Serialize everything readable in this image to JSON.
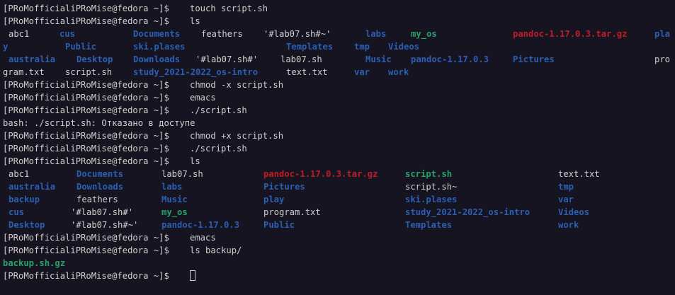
{
  "colors": {
    "background": "#171421",
    "default_text": "#d0cfcc",
    "directory": "#2a5fb3",
    "executable": "#26a269",
    "archive": "#c01c28"
  },
  "prompt": "[PRoMofficialiPRoMise@fedora ~]$",
  "lines": [
    {
      "type": "prompt",
      "cmd": "touch script.sh"
    },
    {
      "type": "prompt",
      "cmd": "ls"
    },
    {
      "type": "ls",
      "items": [
        {
          "text": "abc1",
          "kind": "def",
          "col": 1
        },
        {
          "text": "cus",
          "kind": "dir",
          "col": 10
        },
        {
          "text": "Documents",
          "kind": "dir",
          "col": 23
        },
        {
          "text": "feathers",
          "kind": "def",
          "col": 35
        },
        {
          "text": "'#lab07.sh#~'",
          "kind": "def",
          "col": 46
        },
        {
          "text": "labs",
          "kind": "dir",
          "col": 64
        },
        {
          "text": "my_os",
          "kind": "exe",
          "col": 72
        },
        {
          "text": "pandoc-1.17.0.3.tar.gz",
          "kind": "arc",
          "col": 90
        },
        {
          "text": "pla",
          "kind": "dir",
          "col": 115
        }
      ]
    },
    {
      "type": "ls",
      "items": [
        {
          "text": "y",
          "kind": "dir",
          "col": 0
        },
        {
          "text": "Public",
          "kind": "dir",
          "col": 11
        },
        {
          "text": "ski.plases",
          "kind": "dir",
          "col": 23
        },
        {
          "text": "Templates",
          "kind": "dir",
          "col": 50
        },
        {
          "text": "tmp",
          "kind": "dir",
          "col": 62
        },
        {
          "text": "Videos",
          "kind": "dir",
          "col": 68
        }
      ]
    },
    {
      "type": "ls",
      "items": [
        {
          "text": "australia",
          "kind": "dir",
          "col": 1
        },
        {
          "text": "Desktop",
          "kind": "dir",
          "col": 13
        },
        {
          "text": "Downloads",
          "kind": "dir",
          "col": 23
        },
        {
          "text": "'#lab07.sh#'",
          "kind": "def",
          "col": 34
        },
        {
          "text": "lab07.sh",
          "kind": "def",
          "col": 49
        },
        {
          "text": "Music",
          "kind": "dir",
          "col": 64
        },
        {
          "text": "pandoc-1.17.0.3",
          "kind": "dir",
          "col": 72
        },
        {
          "text": "Pictures",
          "kind": "dir",
          "col": 90
        },
        {
          "text": "pro",
          "kind": "def",
          "col": 115
        }
      ]
    },
    {
      "type": "ls",
      "items": [
        {
          "text": "gram.txt",
          "kind": "def",
          "col": 0
        },
        {
          "text": "script.sh",
          "kind": "def",
          "col": 11
        },
        {
          "text": "study_2021-2022_os-intro",
          "kind": "dir",
          "col": 23
        },
        {
          "text": "text.txt",
          "kind": "def",
          "col": 50
        },
        {
          "text": "var",
          "kind": "dir",
          "col": 62
        },
        {
          "text": "work",
          "kind": "dir",
          "col": 68
        }
      ]
    },
    {
      "type": "prompt",
      "cmd": "chmod -x script.sh"
    },
    {
      "type": "prompt",
      "cmd": "emacs"
    },
    {
      "type": "prompt",
      "cmd": "./script.sh"
    },
    {
      "type": "output",
      "text": "bash: ./script.sh: Отказано в доступе"
    },
    {
      "type": "prompt",
      "cmd": "chmod +x script.sh"
    },
    {
      "type": "prompt",
      "cmd": "./script.sh"
    },
    {
      "type": "prompt",
      "cmd": "ls"
    },
    {
      "type": "ls",
      "items": [
        {
          "text": "abc1",
          "kind": "def",
          "col": 1
        },
        {
          "text": "Documents",
          "kind": "dir",
          "col": 13
        },
        {
          "text": "lab07.sh",
          "kind": "def",
          "col": 28
        },
        {
          "text": "pandoc-1.17.0.3.tar.gz",
          "kind": "arc",
          "col": 46
        },
        {
          "text": "script.sh",
          "kind": "exe",
          "col": 71
        },
        {
          "text": "text.txt",
          "kind": "def",
          "col": 98
        }
      ]
    },
    {
      "type": "ls",
      "items": [
        {
          "text": "australia",
          "kind": "dir",
          "col": 1
        },
        {
          "text": "Downloads",
          "kind": "dir",
          "col": 13
        },
        {
          "text": "labs",
          "kind": "dir",
          "col": 28
        },
        {
          "text": "Pictures",
          "kind": "dir",
          "col": 46
        },
        {
          "text": "script.sh~",
          "kind": "def",
          "col": 71
        },
        {
          "text": "tmp",
          "kind": "dir",
          "col": 98
        }
      ]
    },
    {
      "type": "ls",
      "items": [
        {
          "text": "backup",
          "kind": "dir",
          "col": 1
        },
        {
          "text": "feathers",
          "kind": "def",
          "col": 13
        },
        {
          "text": "Music",
          "kind": "dir",
          "col": 28
        },
        {
          "text": "play",
          "kind": "dir",
          "col": 46
        },
        {
          "text": "ski.plases",
          "kind": "dir",
          "col": 71
        },
        {
          "text": "var",
          "kind": "dir",
          "col": 98
        }
      ]
    },
    {
      "type": "ls",
      "items": [
        {
          "text": "cus",
          "kind": "dir",
          "col": 1
        },
        {
          "text": "'#lab07.sh#'",
          "kind": "def",
          "col": 12
        },
        {
          "text": "my_os",
          "kind": "exe",
          "col": 28
        },
        {
          "text": "program.txt",
          "kind": "def",
          "col": 46
        },
        {
          "text": "study_2021-2022_os-intro",
          "kind": "dir",
          "col": 71
        },
        {
          "text": "Videos",
          "kind": "dir",
          "col": 98
        }
      ]
    },
    {
      "type": "ls",
      "items": [
        {
          "text": "Desktop",
          "kind": "dir",
          "col": 1
        },
        {
          "text": "'#lab07.sh#~'",
          "kind": "def",
          "col": 12
        },
        {
          "text": "pandoc-1.17.0.3",
          "kind": "dir",
          "col": 28
        },
        {
          "text": "Public",
          "kind": "dir",
          "col": 46
        },
        {
          "text": "Templates",
          "kind": "dir",
          "col": 71
        },
        {
          "text": "work",
          "kind": "dir",
          "col": 98
        }
      ]
    },
    {
      "type": "prompt",
      "cmd": "emacs"
    },
    {
      "type": "prompt",
      "cmd": "ls backup/"
    },
    {
      "type": "ls",
      "items": [
        {
          "text": "backup.sh.gz",
          "kind": "exe",
          "col": 0
        }
      ]
    },
    {
      "type": "prompt",
      "cmd": "",
      "cursor": true
    }
  ]
}
